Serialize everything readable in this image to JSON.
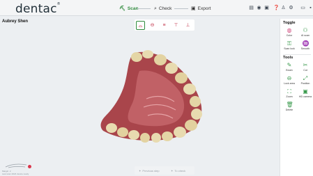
{
  "app": {
    "logo": "dentac",
    "logo_mark": "®"
  },
  "steps": [
    {
      "label": "Scan",
      "icon": "scanner-icon",
      "active": true
    },
    {
      "label": "Check",
      "icon": "magnifier-icon",
      "active": false
    },
    {
      "label": "Export",
      "icon": "export-icon",
      "active": false
    }
  ],
  "top_icons": [
    "save-icon",
    "record-icon",
    "screenshot-icon",
    "help-icon",
    "user-add-icon",
    "settings-icon",
    "window-icon",
    "close-icon"
  ],
  "patient": {
    "name": "Aubrey Shen"
  },
  "view_tools": [
    {
      "name": "upper-jaw-view",
      "glyph": "⌓",
      "active": true
    },
    {
      "name": "lower-jaw-view",
      "glyph": "⊖",
      "active": false
    },
    {
      "name": "bite-view",
      "glyph": "≡",
      "active": false
    },
    {
      "name": "implant-view",
      "glyph": "⊤",
      "active": false
    },
    {
      "name": "extra-view",
      "glyph": "⊥",
      "active": false
    }
  ],
  "panel": {
    "toggle_title": "Toggle",
    "toggles": [
      {
        "label": "Color",
        "icon": "color-icon"
      },
      {
        "label": "AI scan",
        "icon": "ai-scan-icon"
      },
      {
        "label": "Scan lock",
        "icon": "lock-icon"
      },
      {
        "label": "Smooth",
        "icon": "smooth-icon"
      }
    ],
    "tools_title": "Tools",
    "tools": [
      {
        "label": "Brush",
        "icon": "brush-icon"
      },
      {
        "label": "Cut",
        "icon": "cut-icon"
      },
      {
        "label": "Lock area",
        "icon": "lock-area-icon"
      },
      {
        "label": "Position",
        "icon": "position-icon"
      },
      {
        "label": "Zoom",
        "icon": "zoom-icon"
      },
      {
        "label": "HD camera",
        "icon": "camera-icon"
      },
      {
        "label": "Delete",
        "icon": "delete-icon"
      }
    ]
  },
  "bottom_nav": {
    "previous": "Previous step",
    "next": "To check"
  },
  "minimap": {
    "line1": "Margin: 2",
    "line2": "Last scan 2024 device ready"
  },
  "colors": {
    "accent": "#2d8a3a",
    "tissue": "#b04a4f",
    "tooth": "#e6d7aa"
  }
}
